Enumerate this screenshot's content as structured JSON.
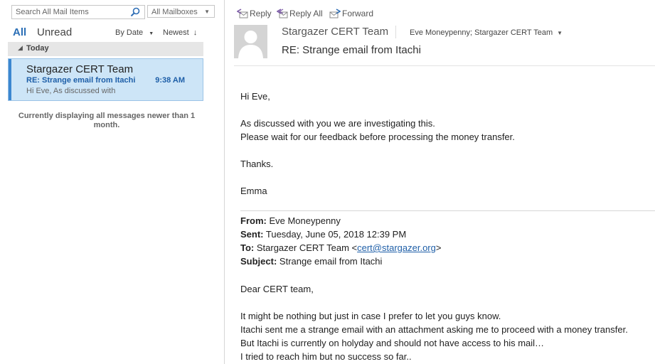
{
  "search": {
    "placeholder": "Search All Mail Items",
    "scope": "All Mailboxes"
  },
  "filters": {
    "all": "All",
    "unread": "Unread",
    "sort_by": "By Date",
    "sort_order": "Newest"
  },
  "group": {
    "label": "Today"
  },
  "mail_item": {
    "sender": "Stargazer CERT Team",
    "subject": "RE: Strange email from Itachi",
    "time": "9:38 AM",
    "preview": "Hi Eve,  As discussed with"
  },
  "list_note": "Currently displaying all messages newer than 1 month.",
  "toolbar": {
    "reply": "Reply",
    "reply_all": "Reply All",
    "forward": "Forward"
  },
  "message": {
    "from": "Stargazer CERT Team",
    "recipients": "Eve Moneypenny; Stargazer CERT Team",
    "subject": "RE: Strange email from Itachi",
    "body": [
      "Hi Eve,",
      "As discussed with you we are investigating this.",
      "Please wait for our feedback before processing the money transfer.",
      "Thanks.",
      "Emma"
    ],
    "quoted": {
      "from_label": "From:",
      "from_value": " Eve Moneypenny",
      "sent_label": "Sent:",
      "sent_value": " Tuesday, June 05, 2018 12:39 PM",
      "to_label": "To:",
      "to_value": " Stargazer CERT Team <",
      "to_email": "cert@stargazer.org",
      "to_close": ">",
      "subject_label": "Subject:",
      "subject_value": " Strange email from Itachi",
      "body": [
        "Dear CERT team,",
        "It might be nothing but just in case I prefer to let you guys know.",
        "Itachi sent me a strange email with an attachment asking me to proceed with a money transfer.",
        "But Itachi is currently on holyday and should not have access to his mail…",
        "I tried to reach him but no success so far.."
      ]
    }
  }
}
